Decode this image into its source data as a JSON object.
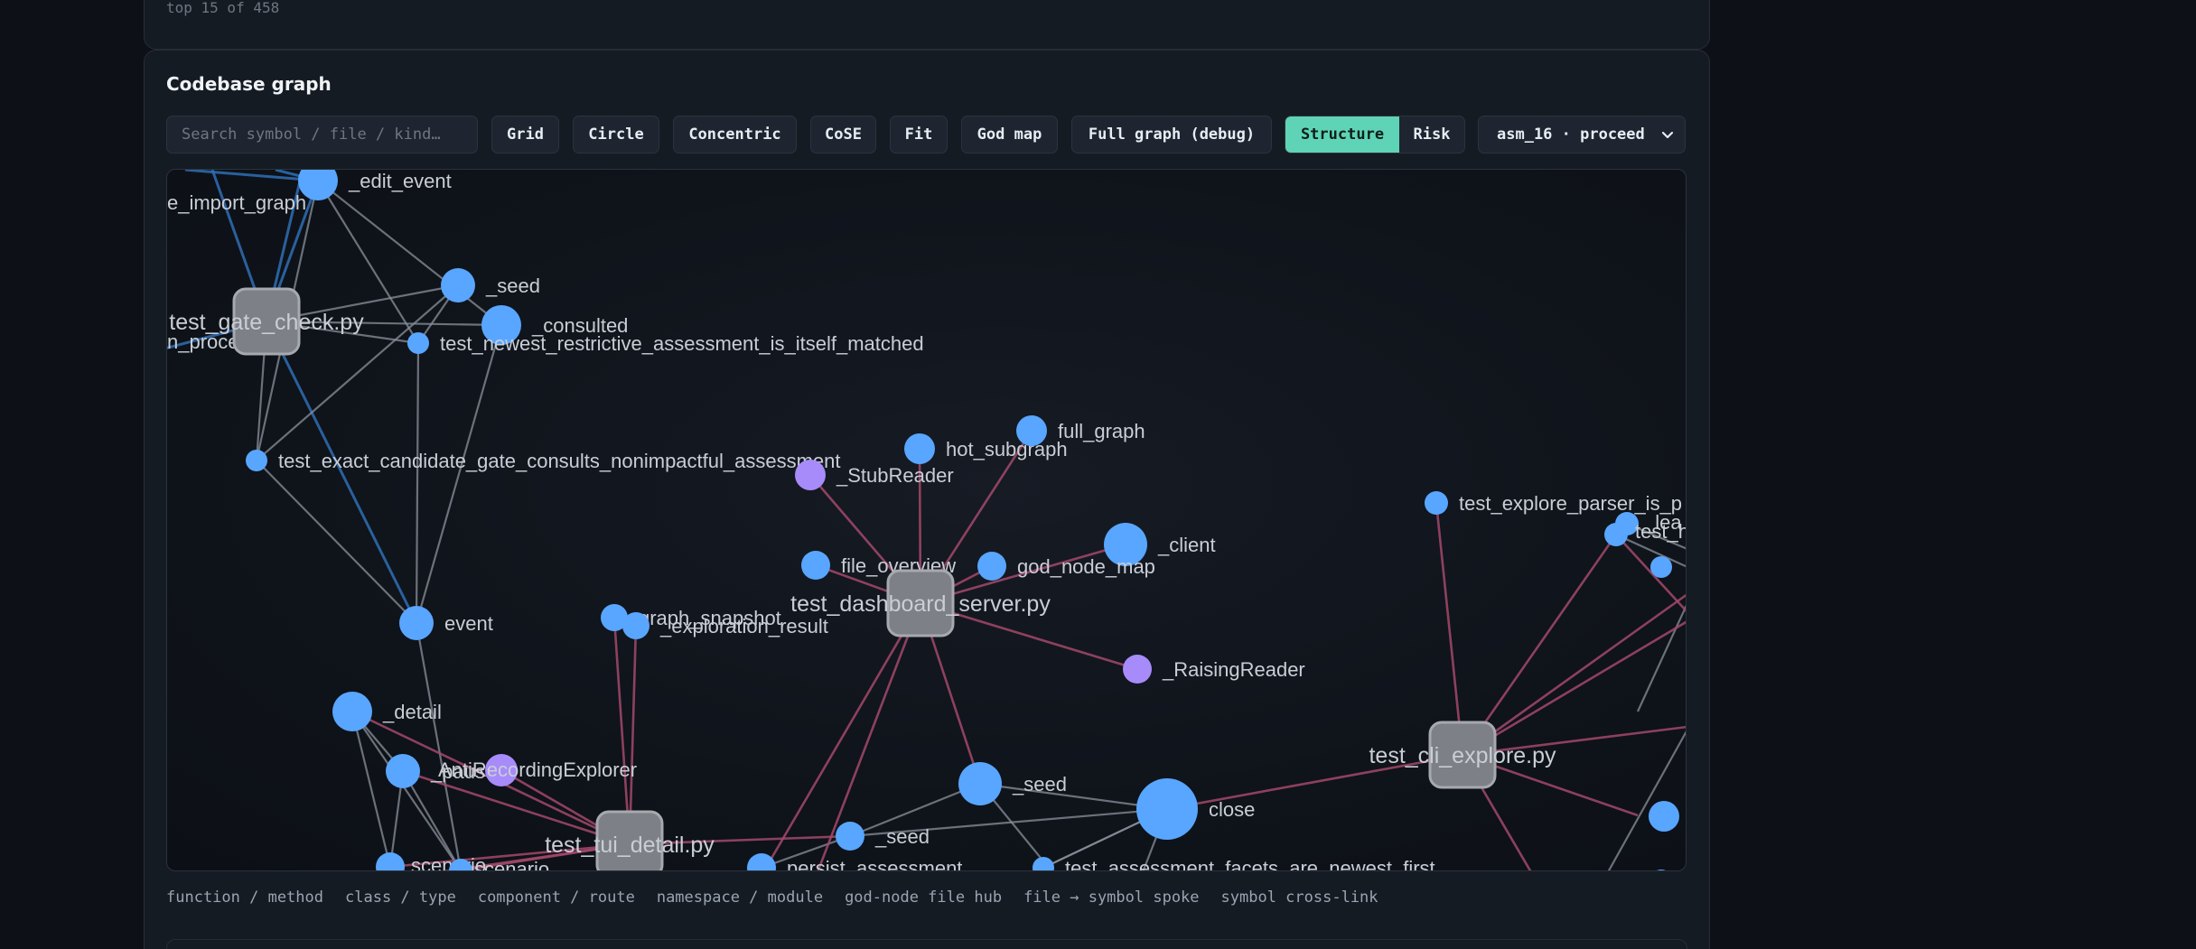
{
  "top_card": {
    "caption": "top 15 of 458"
  },
  "graph_card": {
    "title": "Codebase graph",
    "search_placeholder": "Search symbol / file / kind…",
    "layout_buttons": [
      "Grid",
      "Circle",
      "Concentric",
      "CoSE",
      "Fit",
      "God map",
      "Full graph (debug)"
    ],
    "mode_toggle": {
      "active": "Structure",
      "inactive": "Risk"
    },
    "selector": {
      "value": "asm_16 · proceed",
      "icon": "chevron-down-icon"
    },
    "legend": [
      "function / method",
      "class / type",
      "component / route",
      "namespace / module",
      "god-node file hub",
      "file → symbol spoke",
      "symbol cross-link"
    ]
  },
  "colors": {
    "function_node": "#58a6ff",
    "class_node": "#a78bfa",
    "file_hub": "#7d8086",
    "spoke_edge": "#a3496b",
    "crosslink_edge": "#8b929c",
    "import_edge": "#2f6fb5",
    "accent": "#5fd3b6"
  },
  "graph": {
    "hubs": [
      {
        "label": "test_gate_check.py"
      },
      {
        "label": "test_dashboard_server.py"
      },
      {
        "label": "test_tui_detail.py"
      },
      {
        "label": "test_cli_explore.py"
      }
    ],
    "nodes": [
      {
        "label": "_edit_event",
        "kind": "function"
      },
      {
        "label": "e_import_graph",
        "kind": "function"
      },
      {
        "label": "_seed",
        "kind": "function"
      },
      {
        "label": "_consulted",
        "kind": "function"
      },
      {
        "label": "n_process",
        "kind": "function"
      },
      {
        "label": "test_newest_restrictive_assessment_is_itself_matched",
        "kind": "function"
      },
      {
        "label": "test_exact_candidate_gate_consults_nonimpactful_assessment",
        "kind": "function"
      },
      {
        "label": "_StubReader",
        "kind": "class"
      },
      {
        "label": "hot_subgraph",
        "kind": "function"
      },
      {
        "label": "full_graph",
        "kind": "function"
      },
      {
        "label": "_client",
        "kind": "function"
      },
      {
        "label": "file_overview",
        "kind": "function"
      },
      {
        "label": "god_node_map",
        "kind": "function"
      },
      {
        "label": "event",
        "kind": "function"
      },
      {
        "label": "graph_snapshot",
        "kind": "function"
      },
      {
        "label": "_exploration_result",
        "kind": "function"
      },
      {
        "label": "_RaisingReader",
        "kind": "class"
      },
      {
        "label": "_detail",
        "kind": "function"
      },
      {
        "label": "_paus",
        "kind": "function"
      },
      {
        "label": "AntiRecordingExplorer",
        "kind": "class"
      },
      {
        "label": "_seed",
        "kind": "function"
      },
      {
        "label": "close",
        "kind": "function"
      },
      {
        "label": "_seed",
        "kind": "function"
      },
      {
        "label": "persist_assessment",
        "kind": "function"
      },
      {
        "label": "test_assessment_facets_are_newest_first",
        "kind": "function"
      },
      {
        "label": "scenario",
        "kind": "function"
      },
      {
        "label": "scenario",
        "kind": "function"
      },
      {
        "label": "test_explore_parser_is_p",
        "kind": "function"
      },
      {
        "label": "_lea",
        "kind": "function"
      },
      {
        "label": "test_h",
        "kind": "function"
      }
    ]
  }
}
